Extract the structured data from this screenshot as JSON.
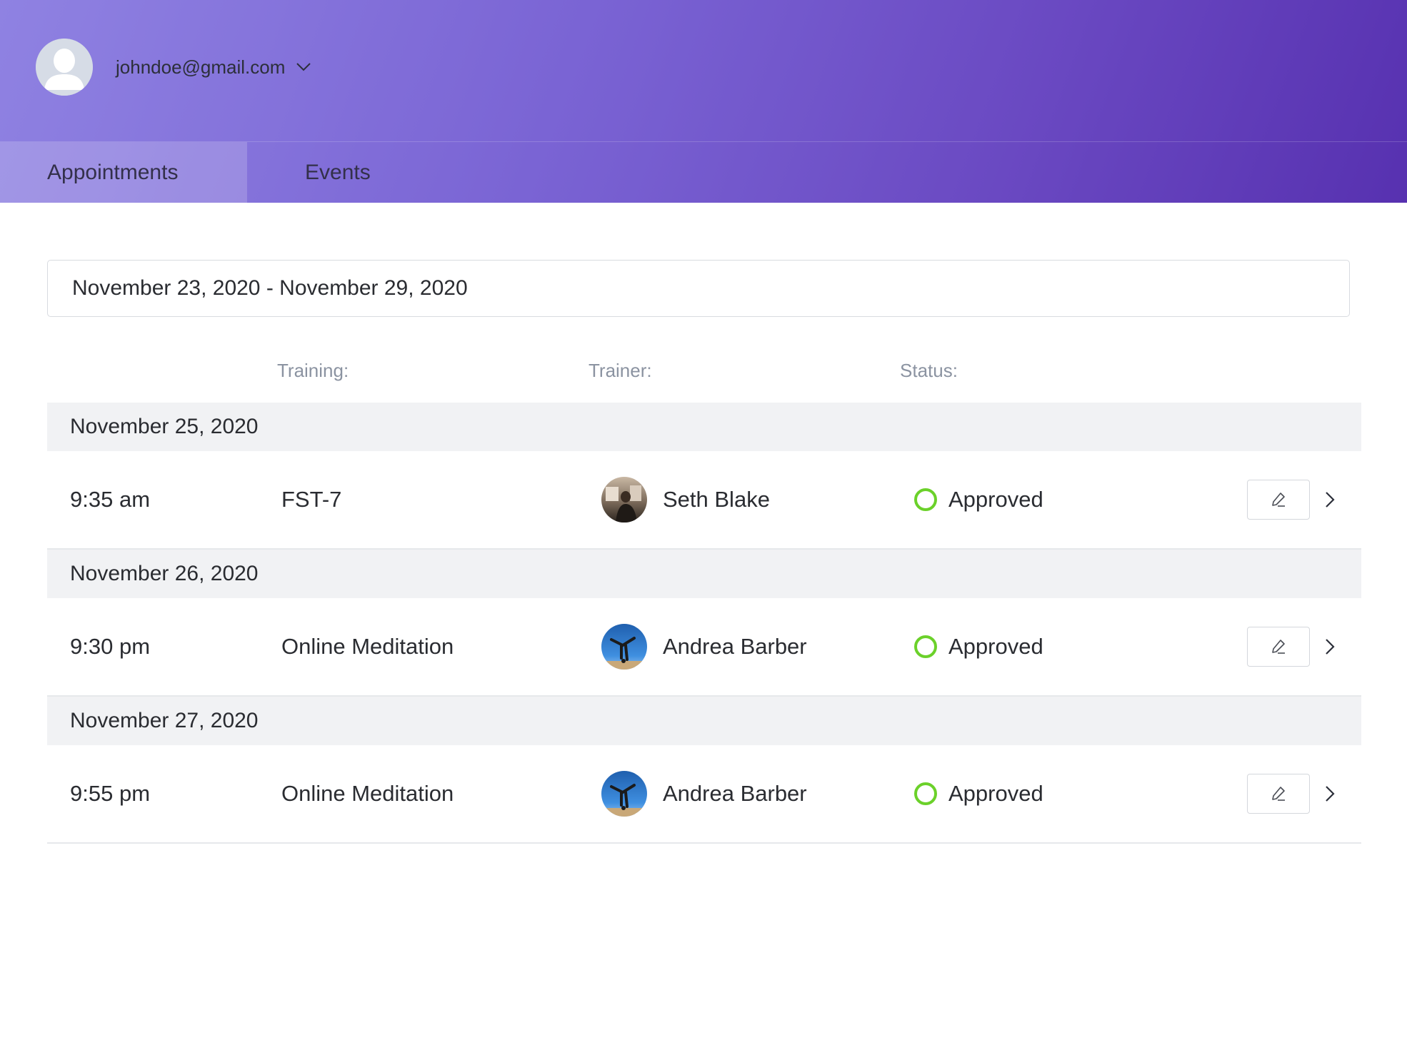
{
  "user": {
    "email": "johndoe@gmail.com",
    "avatar_icon": "user-silhouette-icon",
    "caret_icon": "chevron-down-icon"
  },
  "tabs": [
    {
      "label": "Appointments",
      "active": true
    },
    {
      "label": "Events",
      "active": false
    }
  ],
  "date_range": "November 23, 2020 - November 29, 2020",
  "columns": {
    "training": "Training:",
    "trainer": "Trainer:",
    "status": "Status:"
  },
  "groups": [
    {
      "date": "November 25, 2020",
      "items": [
        {
          "time": "9:35 am",
          "training": "FST-7",
          "trainer": "Seth Blake",
          "status": "Approved"
        }
      ]
    },
    {
      "date": "November 26, 2020",
      "items": [
        {
          "time": "9:30 pm",
          "training": "Online Meditation",
          "trainer": "Andrea Barber",
          "status": "Approved"
        }
      ]
    },
    {
      "date": "November 27, 2020",
      "items": [
        {
          "time": "9:55 pm",
          "training": "Online Meditation",
          "trainer": "Andrea Barber",
          "status": "Approved"
        }
      ]
    }
  ],
  "colors": {
    "header_start": "#8f82e2",
    "header_end": "#5731b0",
    "status_approved": "#6bd12a",
    "group_bg": "#f1f2f4"
  },
  "icons": {
    "edit": "pencil-icon",
    "open": "chevron-right-icon"
  }
}
